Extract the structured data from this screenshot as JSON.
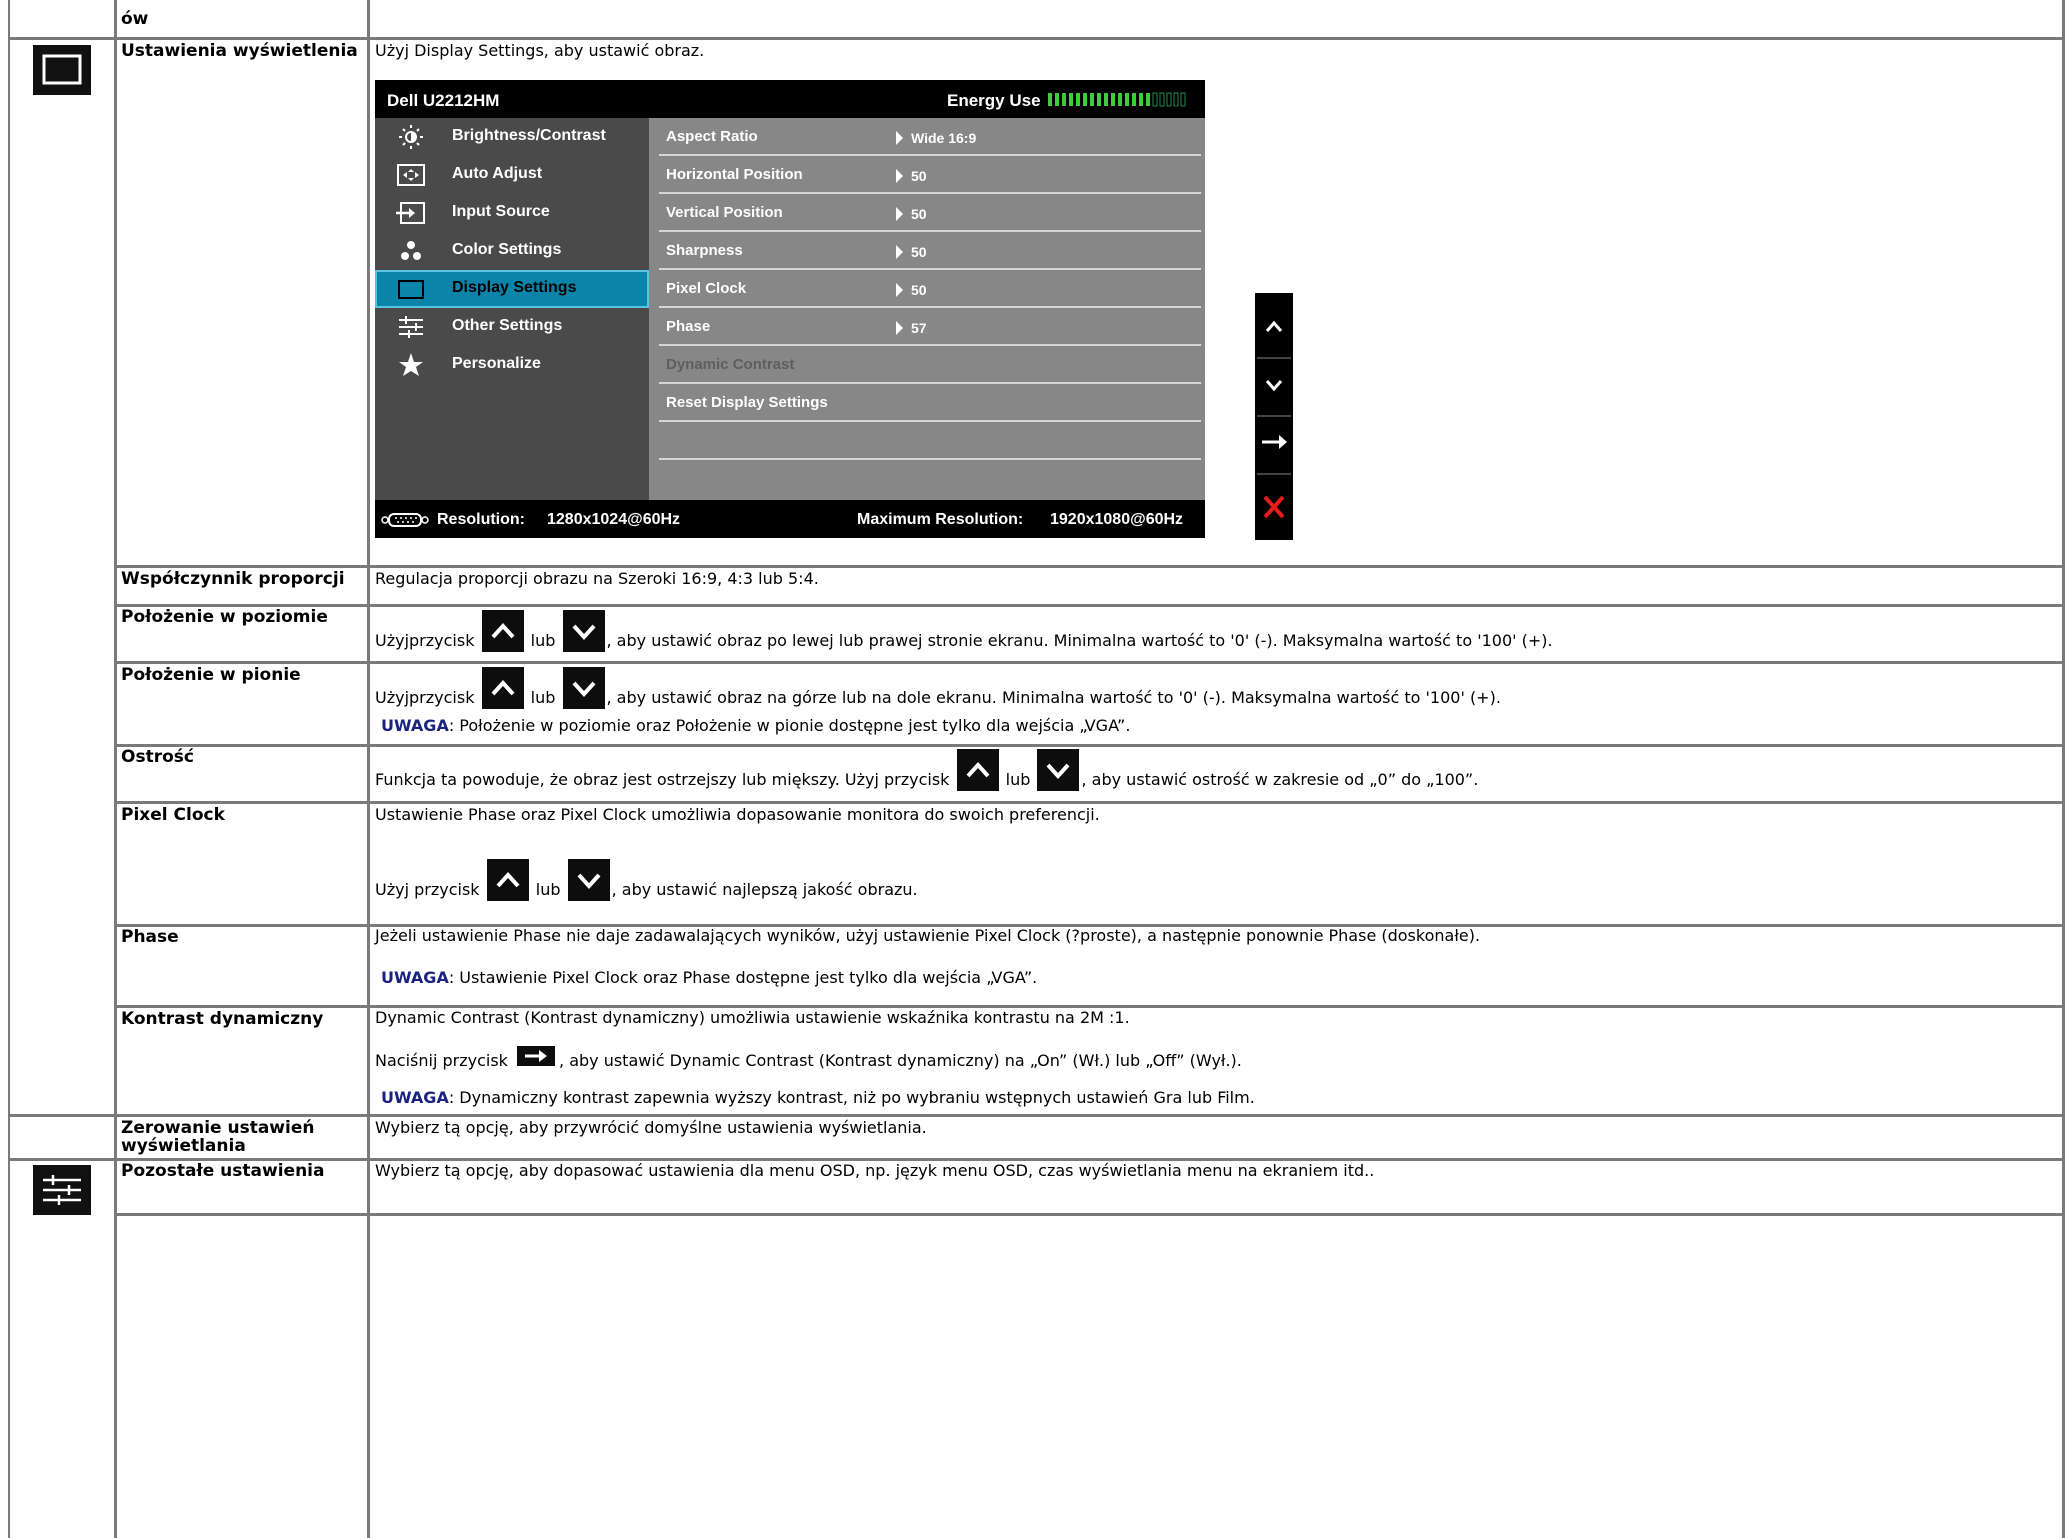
{
  "top_row": {
    "label_fragment": "ów"
  },
  "display_settings": {
    "label": "Ustawienia wyświetlenia",
    "intro": "Użyj Display Settings, aby ustawić obraz.",
    "icon": "display-settings-icon"
  },
  "osd": {
    "model": "Dell U2212HM",
    "energy_label": "Energy Use",
    "menu": [
      {
        "label": "Brightness/Contrast",
        "icon": "brightness-icon"
      },
      {
        "label": "Auto Adjust",
        "icon": "auto-adjust-icon"
      },
      {
        "label": "Input Source",
        "icon": "input-source-icon"
      },
      {
        "label": "Color Settings",
        "icon": "color-settings-icon"
      },
      {
        "label": "Display Settings",
        "icon": "display-settings-icon",
        "selected": true
      },
      {
        "label": "Other Settings",
        "icon": "other-settings-icon"
      },
      {
        "label": "Personalize",
        "icon": "star-icon"
      }
    ],
    "rows": [
      {
        "label": "Aspect Ratio",
        "value": "Wide 16:9"
      },
      {
        "label": "Horizontal Position",
        "value": "50"
      },
      {
        "label": "Vertical Position",
        "value": "50"
      },
      {
        "label": "Sharpness",
        "value": "50"
      },
      {
        "label": "Pixel Clock",
        "value": "50"
      },
      {
        "label": "Phase",
        "value": "57"
      },
      {
        "label": "Dynamic Contrast",
        "value": "",
        "disabled": true
      },
      {
        "label": "Reset Display Settings",
        "value": ""
      }
    ],
    "footer_resolution_label": "Resolution:",
    "footer_resolution": "1280x1024@60Hz",
    "footer_max_label": "Maximum Resolution:",
    "footer_max": "1920x1080@60Hz",
    "nav_buttons": [
      "up-arrow-icon",
      "down-arrow-icon",
      "right-arrow-icon",
      "close-icon"
    ]
  },
  "rows": {
    "aspect": {
      "label": "Współczynnik proporcji",
      "text": "Regulacja proporcji obrazu na Szeroki 16:9, 4:3 lub 5:4."
    },
    "hpos": {
      "label": "Położenie w poziomie",
      "pre": "Użyjprzycisk",
      "mid": "lub",
      "post": ", aby ustawić obraz po lewej lub prawej stronie ekranu. Minimalna wartość to '0' (-). Maksymalna wartość to '100' (+)."
    },
    "vpos": {
      "label": "Położenie w pionie",
      "pre": "Użyjprzycisk",
      "mid": "lub",
      "post": ", aby ustawić obraz na górze lub na dole ekranu. Minimalna wartość to '0' (-). Maksymalna wartość to '100' (+).",
      "note_key": "UWAGA",
      "note": ": Położenie w poziomie oraz Położenie w pionie dostępne jest tylko dla wejścia „VGA”."
    },
    "sharp": {
      "label": "Ostrość",
      "pre": "Funkcja ta powoduje, że obraz jest ostrzejszy lub miększy. Użyj przycisk",
      "mid": "lub",
      "post": ", aby ustawić ostrość w zakresie od „0” do „100”."
    },
    "pixel": {
      "label": "Pixel Clock",
      "text": "Ustawienie Phase oraz Pixel Clock umożliwia dopasowanie monitora do swoich preferencji.",
      "pre": "Użyj przycisk",
      "mid": "lub",
      "post": ", aby ustawić najlepszą jakość obrazu."
    },
    "phase": {
      "label": "Phase",
      "text": "Jeżeli ustawienie Phase nie daje zadawalających wyników, użyj ustawienie Pixel Clock (?proste), a następnie ponownie Phase (doskonałe).",
      "note_key": "UWAGA",
      "note": ": Ustawienie Pixel Clock oraz Phase dostępne jest tylko dla wejścia „VGA”."
    },
    "dyn": {
      "label": "Kontrast dynamiczny",
      "text": "Dynamic Contrast (Kontrast dynamiczny) umożliwia ustawienie wskaźnika kontrastu na 2M :1.",
      "pre": "Naciśnij przycisk",
      "post": ", aby ustawić Dynamic Contrast (Kontrast dynamiczny) na „On” (Wł.) lub „Off” (Wył.).",
      "note_key": "UWAGA",
      "note": ": Dynamiczny kontrast zapewnia wyższy kontrast, niż po wybraniu wstępnych ustawień Gra lub Film."
    },
    "reset": {
      "label_line1": "Zerowanie ustawień",
      "label_line2": "wyświetlania",
      "text": "Wybierz tą opcję, aby przywrócić domyślne ustawienia wyświetlania."
    },
    "other": {
      "label": "Pozostałe ustawienia",
      "text": "Wybierz tą opcję, aby dopasować ustawienia dla menu OSD, np. język menu OSD, czas wyświetlania menu na ekraniem itd..",
      "icon": "other-settings-icon"
    }
  }
}
